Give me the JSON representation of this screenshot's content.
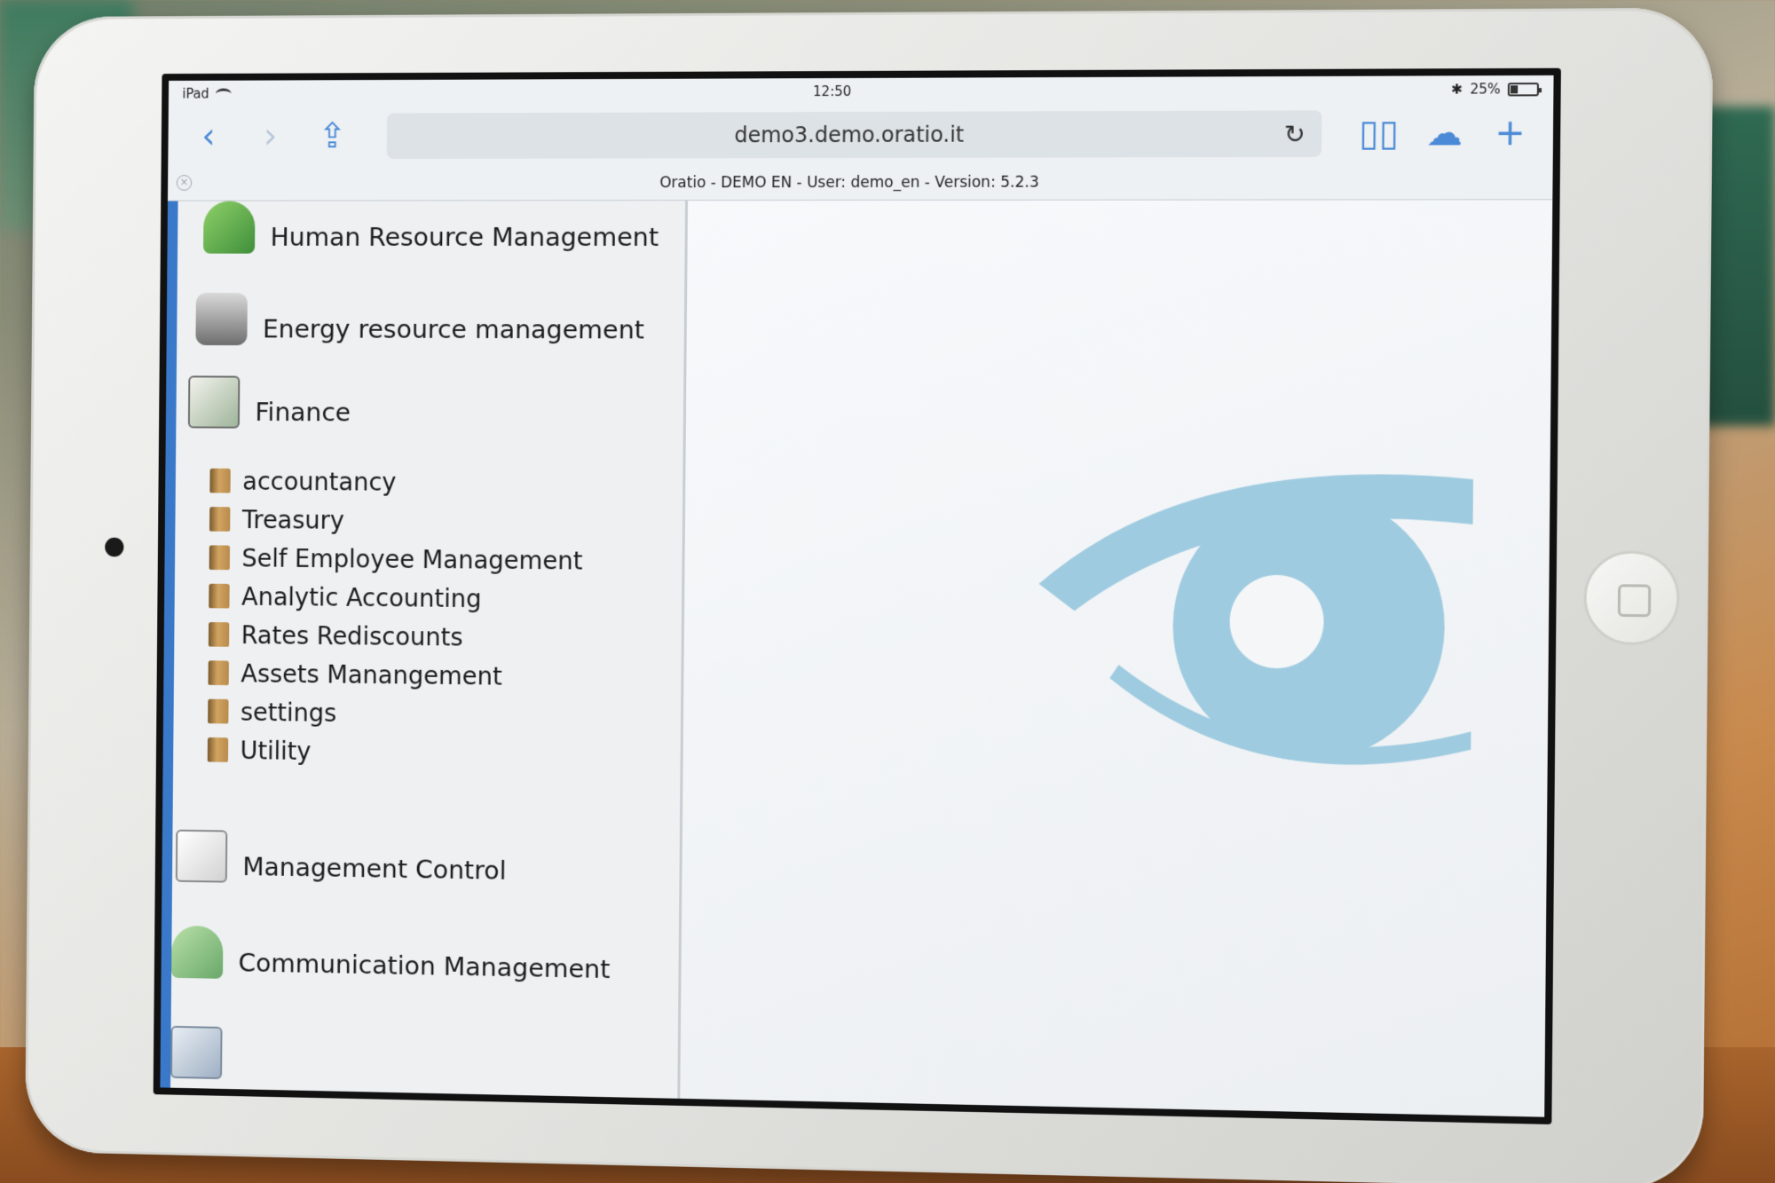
{
  "status_bar": {
    "device": "iPad",
    "time": "12:50",
    "battery": "25%"
  },
  "browser": {
    "url": "demo3.demo.oratio.it",
    "page_title": "Oratio - DEMO EN - User: demo_en - Version: 5.2.3"
  },
  "menu": {
    "hr": "Human Resource Management",
    "energy": "Energy resource management",
    "finance": "Finance",
    "finance_items": [
      "accountancy",
      "Treasury",
      "Self Employee Management",
      "Analytic Accounting",
      "Rates Rediscounts",
      "Assets Manangement",
      "settings",
      "Utility"
    ],
    "management_control": "Management Control",
    "communication": "Communication Management"
  },
  "colors": {
    "accent": "#3a78c9",
    "logo": "#9fcbe0"
  }
}
